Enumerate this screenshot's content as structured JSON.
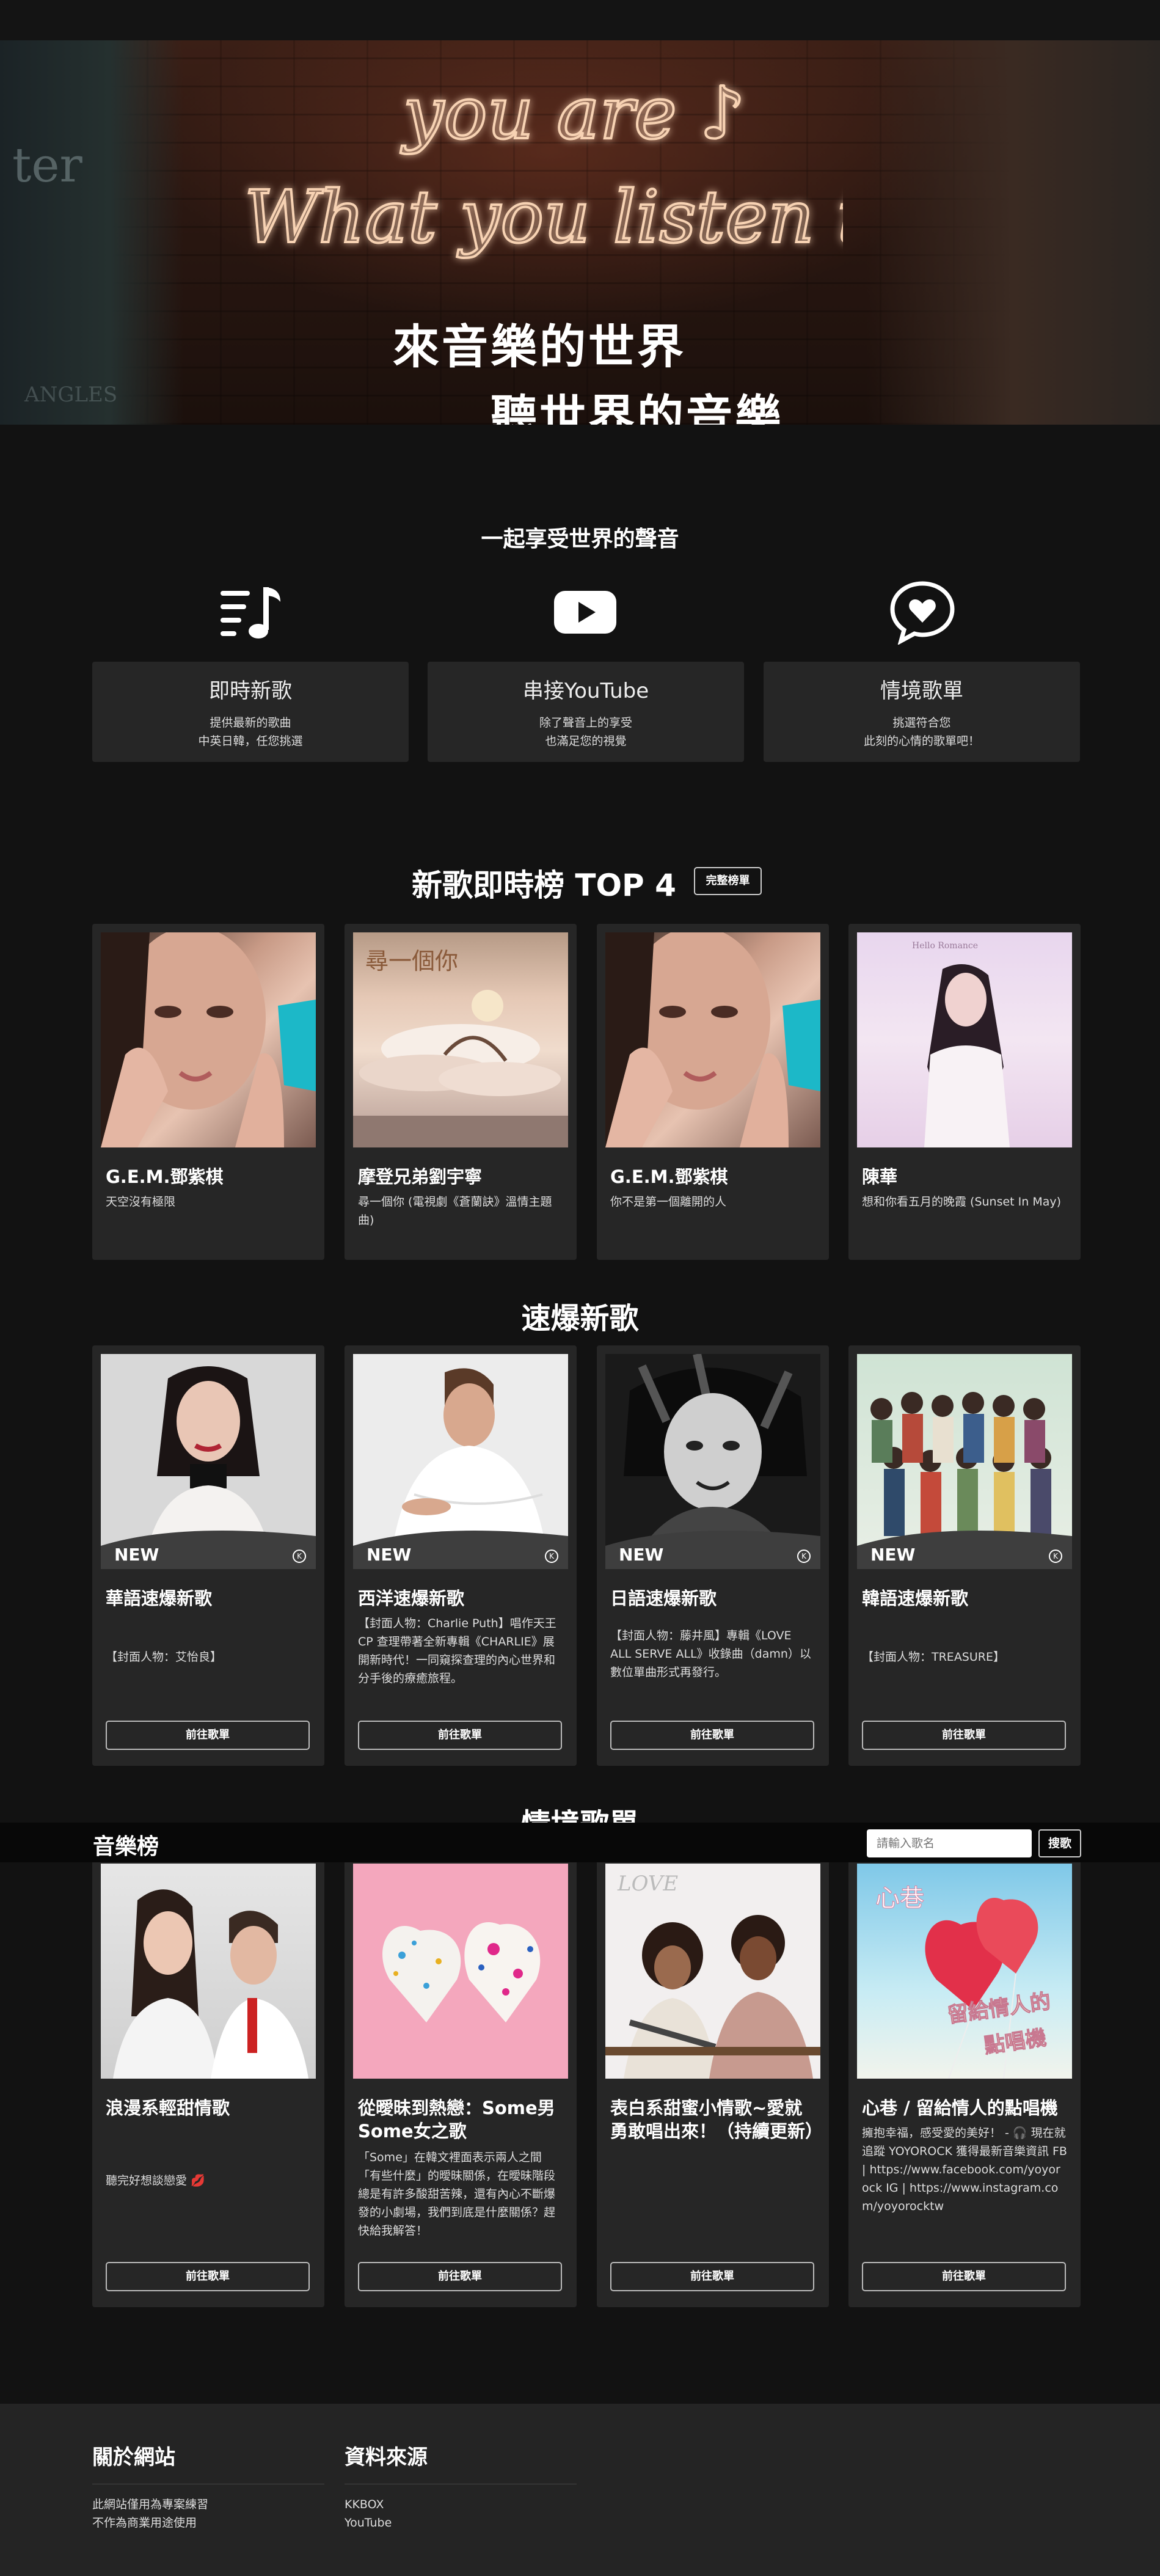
{
  "hero": {
    "neon_line1": "you are ♪",
    "neon_line2": "What you listen to",
    "line1": "來音樂的世界",
    "line2": "聽世界的音樂",
    "shelf_sign": "ter",
    "shelf_sign2": "ANGLES"
  },
  "features": {
    "title": "一起享受世界的聲音",
    "items": [
      {
        "icon": "music-list-icon",
        "title": "即時新歌",
        "desc1": "提供最新的歌曲",
        "desc2": "中英日韓，任您挑選"
      },
      {
        "icon": "youtube-icon",
        "title": "串接YouTube",
        "desc1": "除了聲音上的享受",
        "desc2": "也滿足您的視覺"
      },
      {
        "icon": "heart-chat-icon",
        "title": "情境歌單",
        "desc1": "挑選符合您",
        "desc2": "此刻的心情的歌單吧！"
      }
    ]
  },
  "top4": {
    "title": "新歌即時榜 TOP 4",
    "button": "完整榜單",
    "items": [
      {
        "artist": "G.E.M.鄧紫棋",
        "song": "天空沒有極限"
      },
      {
        "artist": "摩登兄弟劉宇寧",
        "song": "尋一個你 (電視劇《蒼蘭訣》溫情主題曲)"
      },
      {
        "artist": "G.E.M.鄧紫棋",
        "song": "你不是第一個離開的人"
      },
      {
        "artist": "陳華",
        "song": "想和你看五月的晚霞 (Sunset In May)"
      }
    ],
    "album_text_2": "尋一個你",
    "album_text_4": "Hello Romance"
  },
  "hot": {
    "title": "速爆新歌",
    "new_label": "NEW",
    "button": "前往歌單",
    "items": [
      {
        "title": "華語速爆新歌",
        "desc": "【封面人物：艾怡良】"
      },
      {
        "title": "西洋速爆新歌",
        "desc": "【封面人物：Charlie Puth】唱作天王 CP 查理帶著全新專輯《CHARLIE》展開新時代！一同窺探查理的內心世界和分手後的療癒旅程。"
      },
      {
        "title": "日語速爆新歌",
        "desc": "【封面人物：藤井風】專輯《LOVE ALL SERVE ALL》收錄曲（damn）以數位單曲形式再發行。"
      },
      {
        "title": "韓語速爆新歌",
        "desc": "【封面人物：TREASURE】"
      }
    ]
  },
  "mood": {
    "title": "情境歌單",
    "button": "前往歌單",
    "items": [
      {
        "title": "浪漫系輕甜情歌",
        "desc": "聽完好想談戀愛 💋"
      },
      {
        "title": "從曖昧到熱戀：Some男Some女之歌",
        "desc": "「Some」在韓文裡面表示兩人之間「有些什麼」的曖昧關係，在曖昧階段總是有許多酸甜苦辣，還有內心不斷爆發的小劇場，我們到底是什麼關係？趕快給我解答！"
      },
      {
        "title": "表白系甜蜜小情歌~愛就勇敢唱出來！（持續更新）",
        "desc": ""
      },
      {
        "title": "心巷 / 留給情人的點唱機",
        "desc": "擁抱幸福，感受愛的美好！ - 🎧 現在就追蹤 YOYOROCK 獲得最新音樂資訊 FB | https://www.facebook.com/yoyorock IG | https://www.instagram.com/yoyorocktw"
      }
    ],
    "card3_overlay": "LOVE",
    "card4_overlay1": "心巷",
    "card4_overlay2": "留給情人的",
    "card4_overlay3": "點唱機"
  },
  "searchbar": {
    "brand": "音樂榜",
    "placeholder": "請輸入歌名",
    "button": "搜歌"
  },
  "footer": {
    "about_title": "關於網站",
    "about_line1": "此網站僅用為專案練習",
    "about_line2": "不作為商業用途使用",
    "source_title": "資料來源",
    "source_line1": "KKBOX",
    "source_line2": "YouTube"
  },
  "colors": {
    "background": "#121212",
    "card": "#262626",
    "footer": "#242424",
    "searchbar": "#080808"
  }
}
